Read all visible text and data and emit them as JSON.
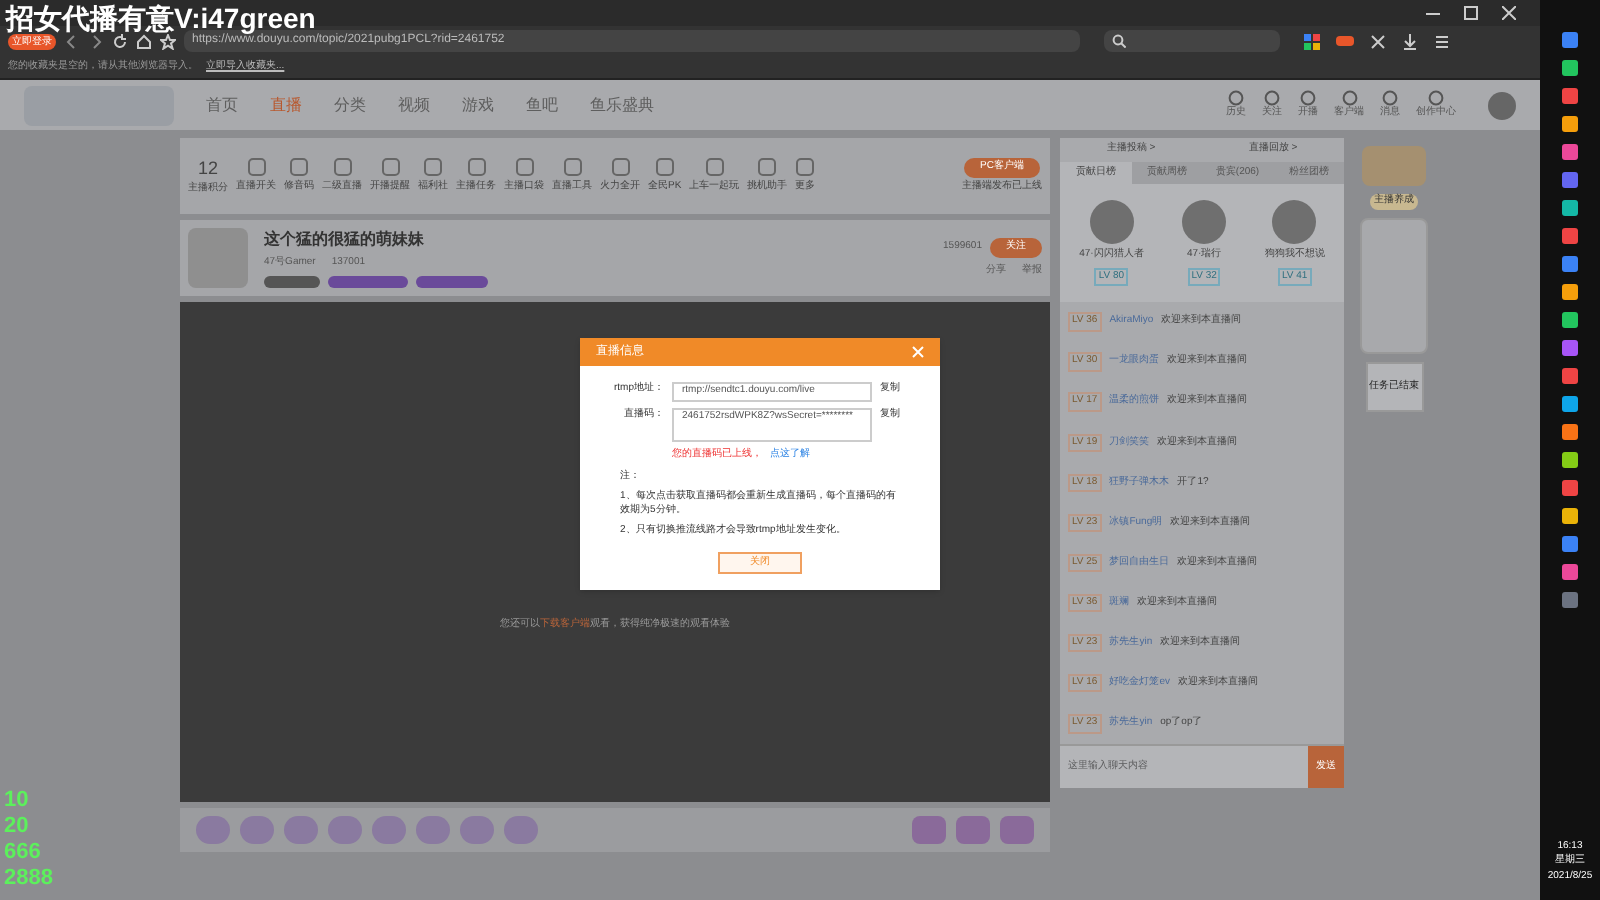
{
  "overlay_caption": "招女代播有意V:i47green",
  "browser": {
    "login_badge": "立即登录",
    "url": "https://www.douyu.com/topic/2021pubg1PCL?rid=2461752",
    "bookmark_notice": "您的收藏夹是空的，请从其他浏览器导入。",
    "bookmark_link": "立即导入收藏夹..."
  },
  "site_nav": {
    "items": [
      {
        "label": "首页",
        "selected": false
      },
      {
        "label": "直播",
        "selected": true
      },
      {
        "label": "分类",
        "selected": false
      },
      {
        "label": "视频",
        "selected": false
      },
      {
        "label": "游戏",
        "selected": false
      },
      {
        "label": "鱼吧",
        "selected": false
      },
      {
        "label": "鱼乐盛典",
        "selected": false
      }
    ],
    "header_icons": [
      "历史",
      "关注",
      "开播",
      "客户端",
      "消息",
      "创作中心"
    ]
  },
  "tools": {
    "score": "12",
    "score_label": "主播积分",
    "items": [
      "直播开关",
      "修音码",
      "二级直播",
      "开播提醒",
      "福利社",
      "主播任务",
      "主播口袋",
      "直播工具",
      "火力全开",
      "全民PK",
      "上车一起玩",
      "挑机助手",
      "更多"
    ],
    "pc_button": "PC客户端",
    "pc_note": "主播端发布已上线"
  },
  "room": {
    "title": "这个猛的很猛的萌妹妹",
    "streamer": "47号Gamer",
    "heat": "137001",
    "followers": "1599601",
    "follow_button": "关注",
    "share": "分享",
    "report": "举报"
  },
  "video_hint": {
    "before": "您还可以",
    "link": "下载客户端",
    "after": "观看，获得纯净极速的观看体验"
  },
  "modal": {
    "title": "直播信息",
    "rtmp_label": "rtmp地址：",
    "rtmp_value": "rtmp://sendtc1.douyu.com/live",
    "code_label": "直播码：",
    "code_value": "2461752rsdWPK8Z?wsSecret=********",
    "copy_rtmp": "复制",
    "copy_code": "复制",
    "status": "您的直播码已上线，",
    "status_link": "点这了解",
    "note_title": "注：",
    "notes": [
      "1、每次点击获取直播码都会重新生成直播码，每个直播码的有效期为5分钟。",
      "2、只有切换推流线路才会导致rtmp地址发生变化。"
    ],
    "button": "关闭"
  },
  "chat": {
    "header_links": [
      "主播投稿 >",
      "直播回放 >"
    ],
    "tabs": [
      {
        "label": "贡献日榜",
        "selected": true
      },
      {
        "label": "贡献周榜",
        "selected": false
      },
      {
        "label": "贵宾(206)",
        "selected": false
      },
      {
        "label": "粉丝团榜",
        "selected": false
      }
    ],
    "top_fans": [
      {
        "name": "47·闪闪猎人者",
        "level": "LV 80"
      },
      {
        "name": "47·瑞行",
        "level": "LV 32"
      },
      {
        "name": "狗狗我不想说",
        "level": "LV 41"
      }
    ],
    "messages": [
      {
        "level": "LV 36",
        "user": "AkiraMiyo",
        "text": "欢迎来到本直播间"
      },
      {
        "level": "LV 30",
        "user": "一龙眼肉蛋",
        "text": "欢迎来到本直播间"
      },
      {
        "level": "LV 17",
        "user": "温柔的煎饼",
        "text": "欢迎来到本直播间"
      },
      {
        "level": "LV 19",
        "user": "刀剑笑笑",
        "text": "欢迎来到本直播间"
      },
      {
        "level": "LV 18",
        "user": "狂野子弹木木",
        "text": "开了1?"
      },
      {
        "level": "LV 23",
        "user": "冰镇Fung明",
        "text": "欢迎来到本直播间"
      },
      {
        "level": "LV 25",
        "user": "梦回自由生日",
        "text": "欢迎来到本直播间"
      },
      {
        "level": "LV 36",
        "user": "斑斓",
        "text": "欢迎来到本直播间"
      },
      {
        "level": "LV 23",
        "user": "苏先生yin",
        "text": "欢迎来到本直播间"
      },
      {
        "level": "LV 16",
        "user": "好吃金灯笼ev",
        "text": "欢迎来到本直播间"
      },
      {
        "level": "LV 23",
        "user": "苏先生yin",
        "text": "op了op了"
      }
    ],
    "input_placeholder": "这里输入聊天内容",
    "send": "发送"
  },
  "side_banner": {
    "label": "主播养成",
    "task": "任务已结束"
  },
  "counters": [
    "10",
    "20",
    "666",
    "2888"
  ],
  "taskbar": {
    "time": "16:13",
    "weekday": "星期三",
    "date": "2021/8/25"
  }
}
